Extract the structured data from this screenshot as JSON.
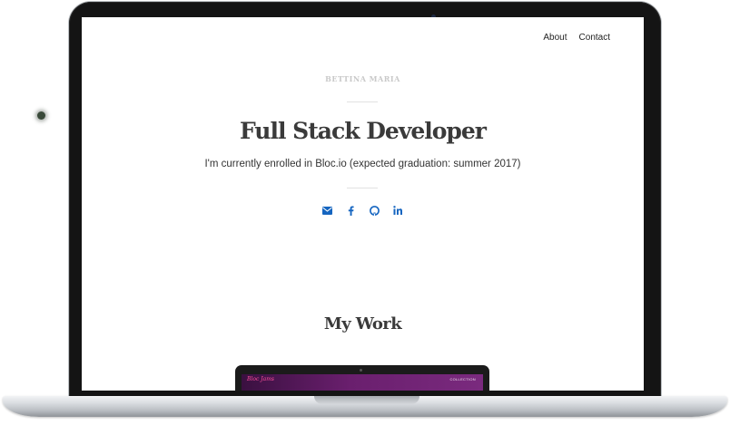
{
  "nav": {
    "items": [
      "About",
      "Contact"
    ]
  },
  "hero": {
    "brand": "BETTINA MARIA",
    "title": "Full Stack Developer",
    "subtitle": "I'm currently enrolled in Bloc.io (expected graduation: summer 2017)"
  },
  "social": {
    "color": "#1565c0",
    "icons": [
      "envelope-icon",
      "facebook-icon",
      "github-icon",
      "linkedin-icon"
    ]
  },
  "work": {
    "title": "My Work"
  },
  "preview": {
    "logo": "Bloc Jams",
    "nav": "COLLECTION"
  }
}
